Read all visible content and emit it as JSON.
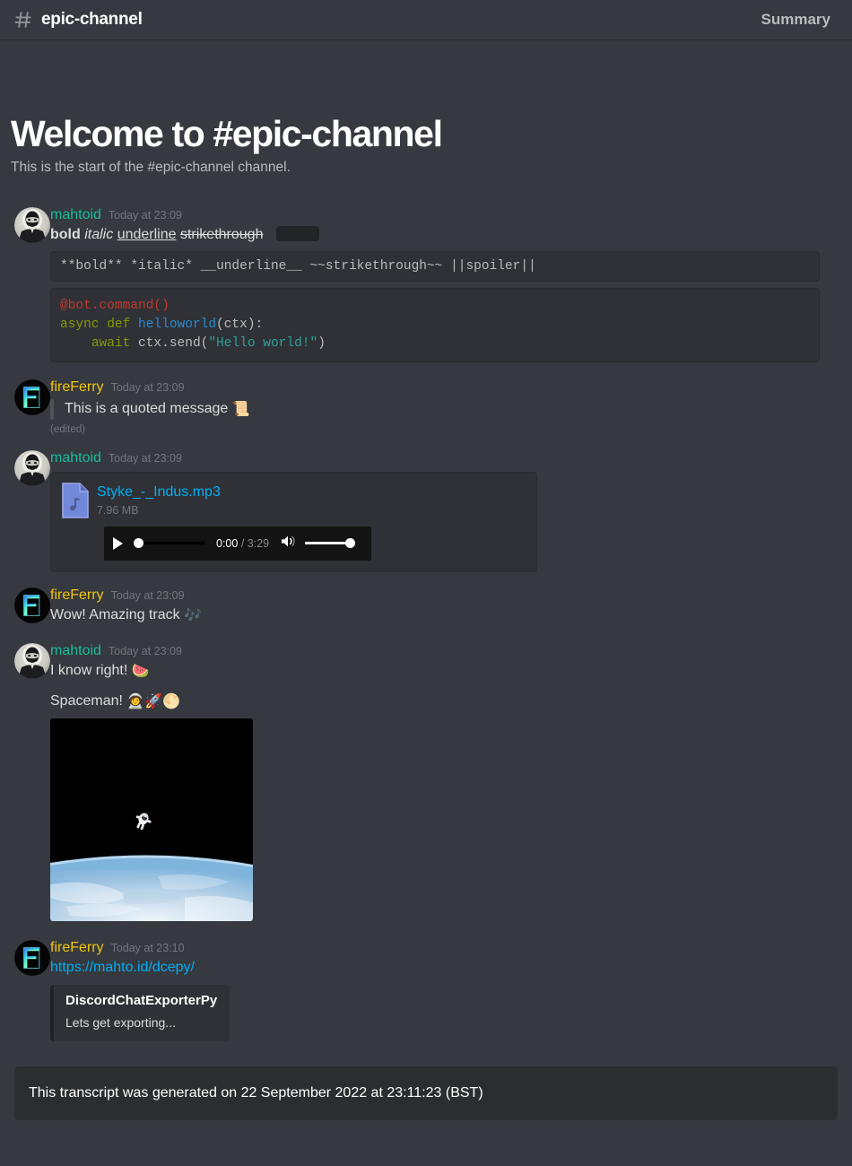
{
  "header": {
    "hash_icon": "hash-icon",
    "channel_name": "epic-channel",
    "summary_label": "Summary"
  },
  "welcome": {
    "title": "Welcome to #epic-channel",
    "subtitle": "This is the start of the #epic-channel channel."
  },
  "colors": {
    "background": "#36393f",
    "author_mahtoid": "#1abc9c",
    "author_fireferry": "#f1c40f",
    "link": "#00aff4",
    "code_bg": "#2f3136",
    "embed_bar": "#202225",
    "footer_bg": "#2b2d31"
  },
  "messages": [
    {
      "author": "mahtoid",
      "timestamp": "Today at 23:09",
      "markdown_demo": {
        "bold": "bold",
        "italic": "italic",
        "underline": "underline",
        "strikethrough": "strikethrough",
        "spoiler": ""
      },
      "inline_code": "**bold** *italic* __underline__ ~~strikethrough~~ ||spoiler||",
      "code_block": {
        "language": "python",
        "line1_decorator": "@bot.command()",
        "line2_kw": "async def ",
        "line2_fn": "helloworld",
        "line2_rest": "(ctx):",
        "line3_indent": "    ",
        "line3_kw": "await ",
        "line3_call": "ctx.send(",
        "line3_str": "\"Hello world!\"",
        "line3_end": ")"
      }
    },
    {
      "author": "fireFerry",
      "timestamp": "Today at 23:09",
      "quote": "This is a quoted message",
      "quote_emoji": "📜",
      "edited": "(edited)"
    },
    {
      "author": "mahtoid",
      "timestamp": "Today at 23:09",
      "attachment": {
        "file_name": "Styke_-_Indus.mp3",
        "file_size": "7.96 MB",
        "player": {
          "current_time": "0:00",
          "separator": "/",
          "total_time": "3:29",
          "play_icon": "play-icon",
          "volume_icon": "volume-icon"
        }
      }
    },
    {
      "author": "fireFerry",
      "timestamp": "Today at 23:09",
      "text": "Wow! Amazing track",
      "emoji": "🎶"
    },
    {
      "author": "mahtoid",
      "timestamp": "Today at 23:09",
      "text1": "I know right!",
      "emoji1": "🍉",
      "text2": "Spaceman!",
      "emoji2": "🧑‍🚀🚀🌕",
      "image_attachment": "astronaut-spacewalk-photo"
    },
    {
      "author": "fireFerry",
      "timestamp": "Today at 23:10",
      "link": "https://mahto.id/dcepy/",
      "embed": {
        "title": "DiscordChatExporterPy",
        "description": "Lets get exporting..."
      }
    }
  ],
  "footer": {
    "text": "This transcript was generated on 22 September 2022 at 23:11:23 (BST)"
  }
}
